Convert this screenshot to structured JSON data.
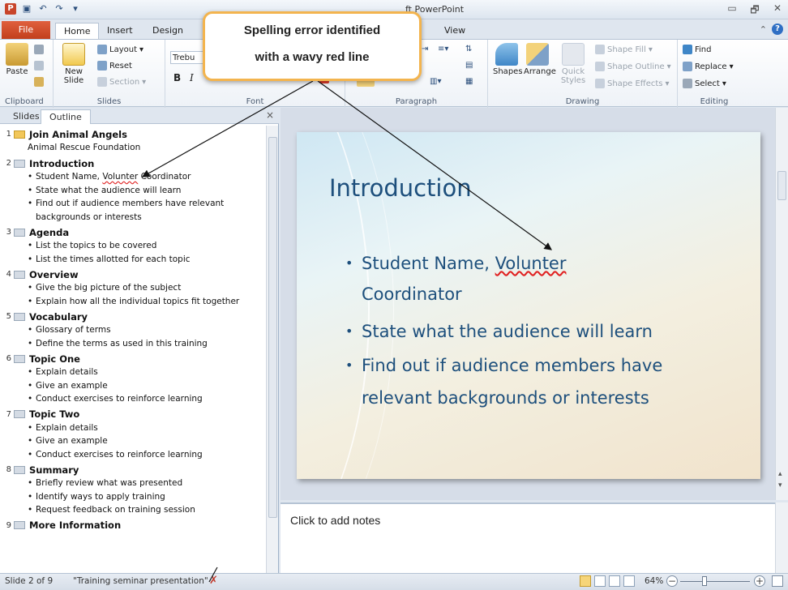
{
  "window": {
    "title": "ft PowerPoint",
    "ctrl_minimize": "▭",
    "ctrl_restore": "🗗",
    "ctrl_close": "✕"
  },
  "qat": {
    "save_icon": "save-icon",
    "undo_glyph": "↶",
    "redo_glyph": "↷"
  },
  "tabs": {
    "file": "File",
    "home": "Home",
    "insert": "Insert",
    "design": "Design",
    "view": "View"
  },
  "ribbon": {
    "clipboard": {
      "label": "Clipboard",
      "paste": "Paste"
    },
    "slides": {
      "label": "Slides",
      "new_slide": "New Slide",
      "layout": "Layout",
      "reset": "Reset",
      "section": "Section"
    },
    "font": {
      "label": "Font",
      "font_name": "Trebu",
      "bold": "B",
      "italic": "I"
    },
    "paragraph": {
      "label": "Paragraph"
    },
    "drawing": {
      "label": "Drawing",
      "shapes": "Shapes",
      "arrange": "Arrange",
      "quick_styles": "Quick Styles",
      "shape_fill": "Shape Fill",
      "shape_outline": "Shape Outline",
      "shape_effects": "Shape Effects"
    },
    "editing": {
      "label": "Editing",
      "find": "Find",
      "replace": "Replace",
      "select": "Select"
    }
  },
  "callout": {
    "line1": "Spelling error identified",
    "line2": "with a wavy red line"
  },
  "pane": {
    "tab_slides": "Slides",
    "tab_outline": "Outline",
    "close": "×"
  },
  "outline": [
    {
      "num": "1",
      "title": "Join Animal Angels",
      "subtitle": "Animal Rescue Foundation",
      "bullets": []
    },
    {
      "num": "2",
      "title": "Introduction",
      "subtitle": null,
      "bullets": [
        "Student Name, Volunter Coordinator",
        "State what the audience will learn",
        "Find out if audience members have relevant backgrounds or interests"
      ]
    },
    {
      "num": "3",
      "title": "Agenda",
      "subtitle": null,
      "bullets": [
        "List the topics to be covered",
        "List the times allotted for each topic"
      ]
    },
    {
      "num": "4",
      "title": "Overview",
      "subtitle": null,
      "bullets": [
        "Give the big picture of the subject",
        "Explain how all the individual topics fit together"
      ]
    },
    {
      "num": "5",
      "title": "Vocabulary",
      "subtitle": null,
      "bullets": [
        "Glossary of terms",
        "Define the terms as used in this training"
      ]
    },
    {
      "num": "6",
      "title": "Topic One",
      "subtitle": null,
      "bullets": [
        "Explain details",
        "Give an example",
        "Conduct exercises to reinforce learning"
      ]
    },
    {
      "num": "7",
      "title": "Topic Two",
      "subtitle": null,
      "bullets": [
        "Explain details",
        "Give an example",
        "Conduct exercises to reinforce learning"
      ]
    },
    {
      "num": "8",
      "title": "Summary",
      "subtitle": null,
      "bullets": [
        "Briefly review what was presented",
        "Identify ways to apply training",
        "Request feedback on training session"
      ]
    },
    {
      "num": "9",
      "title": "More Information",
      "subtitle": null,
      "bullets": []
    }
  ],
  "outline_spell": {
    "before": "Student Name, ",
    "word": "Volunter",
    "after": " Coordinator"
  },
  "slide": {
    "title": "Introduction",
    "b1_before": "Student Name, ",
    "b1_word": "Volunter",
    "b1_line2": "Coordinator",
    "b2": "State what the audience will learn",
    "b3_line1": "Find out if audience members have",
    "b3_line2": "relevant backgrounds or interests"
  },
  "notes": {
    "placeholder": "Click to add notes"
  },
  "status": {
    "slide_pos": "Slide 2 of 9",
    "theme": "\"Training seminar presentation\"",
    "zoom": "64%",
    "zoom_level": 0.64
  },
  "colors": {
    "accent": "#f3b44e",
    "spell": "#e02020",
    "slide_text": "#1d4f7c",
    "file_tab": "#c23f1c"
  }
}
